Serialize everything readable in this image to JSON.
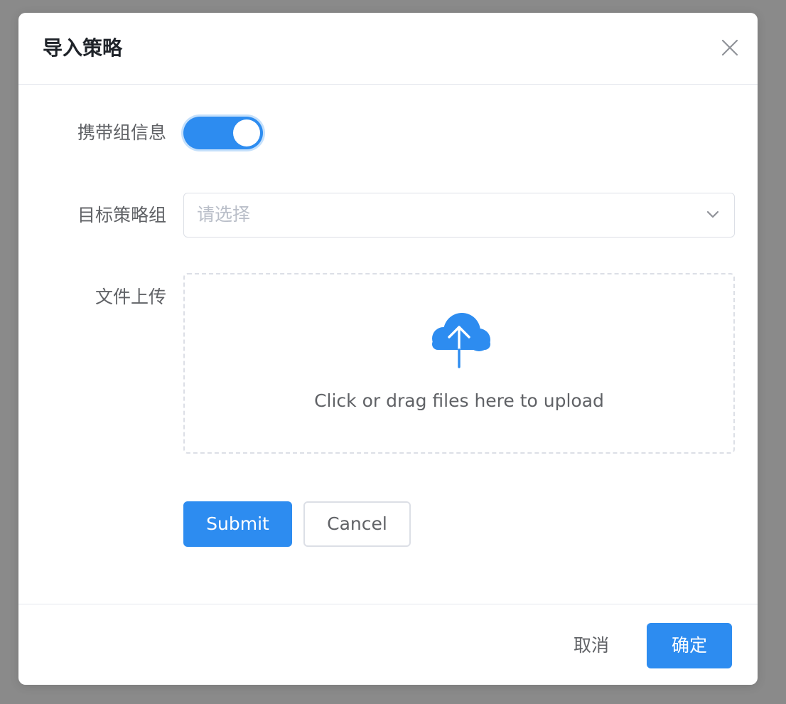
{
  "dialog": {
    "title": "导入策略",
    "close_icon": "close-icon"
  },
  "form": {
    "carry_group_info": {
      "label": "携带组信息",
      "enabled": true,
      "accent": "#2d8cf0"
    },
    "target_group": {
      "label": "目标策略组",
      "placeholder": "请选择",
      "icon": "chevron-down-icon"
    },
    "file_upload": {
      "label": "文件上传",
      "icon": "cloud-upload-icon",
      "hint": "Click or drag files here to upload",
      "icon_color": "#2d8cf0"
    },
    "submit_label": "Submit",
    "cancel_label": "Cancel"
  },
  "footer": {
    "cancel_label": "取消",
    "confirm_label": "确定"
  }
}
